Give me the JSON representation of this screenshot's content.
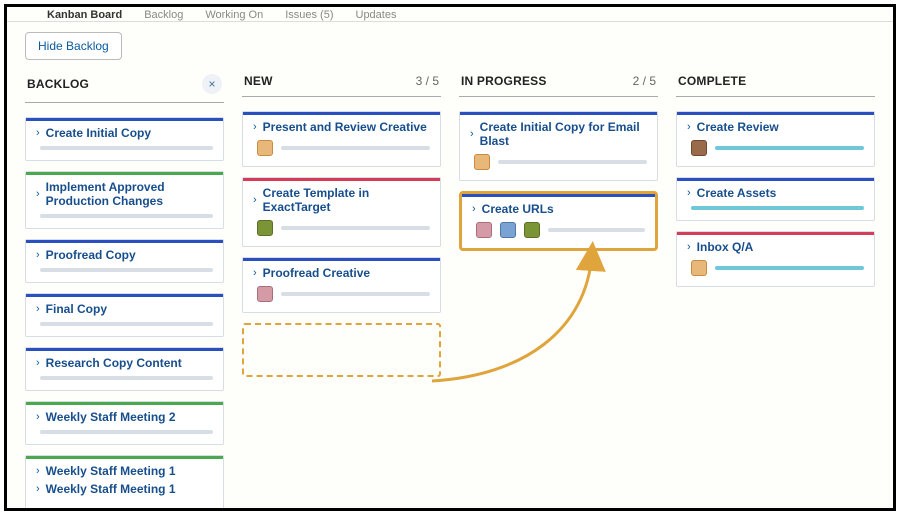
{
  "tabs": {
    "active": "Kanban Board",
    "items": [
      "Kanban Board",
      "Backlog",
      "Working On",
      "Issues (5)",
      "Updates"
    ]
  },
  "hide_backlog_label": "Hide Backlog",
  "columns": {
    "backlog": {
      "title": "BACKLOG",
      "cards": [
        {
          "title": "Create Initial Copy",
          "accent": "blue"
        },
        {
          "title": "Implement Approved Production Changes",
          "accent": "green"
        },
        {
          "title": "Proofread Copy",
          "accent": "blue"
        },
        {
          "title": "Final Copy",
          "accent": "blue"
        },
        {
          "title": "Research Copy Content",
          "accent": "blue"
        },
        {
          "title": "Weekly Staff Meeting 2",
          "accent": "green"
        },
        {
          "title": "Weekly Staff Meeting 1",
          "accent": "green"
        },
        {
          "title2": "Weekly Staff Meeting 1"
        }
      ]
    },
    "new": {
      "title": "NEW",
      "count": "3 / 5",
      "cards": [
        {
          "title": "Present and Review Creative",
          "accent": "blue"
        },
        {
          "title": "Create Template in ExactTarget",
          "accent": "red"
        },
        {
          "title": "Proofread Creative",
          "accent": "blue"
        }
      ]
    },
    "in_progress": {
      "title": "IN PROGRESS",
      "count": "2 / 5",
      "cards": [
        {
          "title": "Create Initial Copy for Email Blast",
          "accent": "blue"
        },
        {
          "title": "Create URLs",
          "accent": "blue"
        }
      ]
    },
    "complete": {
      "title": "COMPLETE",
      "cards": [
        {
          "title": "Create Review",
          "accent": "blue"
        },
        {
          "title": "Create Assets",
          "accent": "blue"
        },
        {
          "title": "Inbox Q/A",
          "accent": "red"
        }
      ]
    }
  }
}
